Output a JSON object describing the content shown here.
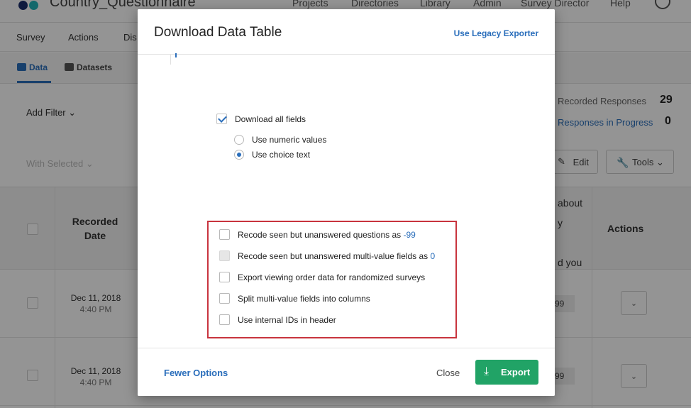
{
  "app": {
    "project_title": "Country_Questionnaire",
    "top_nav": [
      "Projects",
      "Directories",
      "Library",
      "Admin",
      "Survey Director",
      "Help"
    ],
    "sub_nav": [
      "Survey",
      "Actions",
      "Dis"
    ],
    "tabs": [
      "Data",
      "Datasets"
    ],
    "add_filter": "Add Filter ⌄",
    "recorded_label": "Recorded Responses",
    "recorded_count": "29",
    "in_progress_label": "Responses in Progress",
    "in_progress_count": "0",
    "with_selected": "With Selected ⌄",
    "edit_label": "Edit",
    "tools_label": "Tools ⌄",
    "table": {
      "col_recorded": "Recorded\nDate",
      "col_about": "about\ny\n\nd you",
      "col_actions": "Actions",
      "rows": [
        {
          "date": "Dec 11, 2018",
          "time": "4:40 PM",
          "score": "99"
        },
        {
          "date": "Dec 11, 2018",
          "time": "4:40 PM",
          "score": "99"
        }
      ]
    }
  },
  "modal": {
    "title": "Download Data Table",
    "legacy_link": "Use Legacy Exporter",
    "download_all": {
      "label": "Download all fields",
      "checked": true
    },
    "value_options": [
      {
        "label": "Use numeric values",
        "selected": false
      },
      {
        "label": "Use choice text",
        "selected": true
      }
    ],
    "options": [
      {
        "label": "Recode seen but unanswered questions as",
        "value": "-99",
        "checked": false,
        "disabled": false
      },
      {
        "label": "Recode seen but unanswered multi-value fields as",
        "value": "0",
        "checked": false,
        "disabled": true
      },
      {
        "label": "Export viewing order data for randomized surveys",
        "value": null,
        "checked": false,
        "disabled": false
      },
      {
        "label": "Split multi-value fields into columns",
        "value": null,
        "checked": false,
        "disabled": false
      },
      {
        "label": "Use internal IDs in header",
        "value": null,
        "checked": false,
        "disabled": false
      }
    ],
    "fewer_options": "Fewer Options",
    "close": "Close",
    "export": "Export"
  },
  "colors": {
    "accent": "#2a6ebb",
    "export_green": "#21a366",
    "highlight_red": "#c8343e"
  }
}
